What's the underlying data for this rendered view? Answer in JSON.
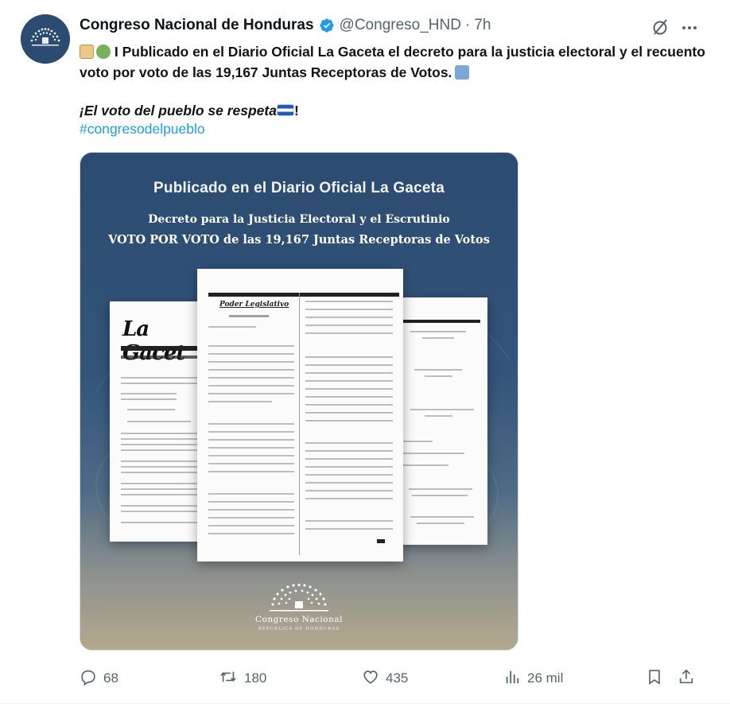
{
  "tweet": {
    "author_name": "Congreso Nacional de Honduras",
    "handle": "@Congreso_HND",
    "separator": "·",
    "time": "7h",
    "text_line1": " I Publicado en el Diario Oficial La Gaceta el decreto para la justicia electoral y el recuento voto por voto de las 19,167 Juntas Receptoras de Votos.",
    "text_line3": "¡El voto del pueblo se respeta",
    "text_line3_end": "!",
    "hashtag": "#congresodelpueblo"
  },
  "media": {
    "title": "Publicado en el Diario Oficial La Gaceta",
    "subtitle1": "Decreto para la Justicia Electoral y el Escrutinio",
    "subtitle2": "VOTO POR VOTO de las 19,167 Juntas Receptoras de Votos",
    "left_doc_logo": "La Gacet",
    "center_doc_heading": "Poder Legislativo",
    "congreso_name": "Congreso Nacional",
    "congreso_sub": "REPÚBLICA DE HONDURAS"
  },
  "actions": {
    "replies": "68",
    "reposts": "180",
    "likes": "435",
    "views": "26 mil"
  },
  "colors": {
    "link": "#1d9bf0",
    "muted": "#536471",
    "verified": "#1d9bf0",
    "media_bg": "#2b4b70"
  },
  "icons": [
    "verified-badge-icon",
    "grok-icon",
    "more-icon",
    "reply-icon",
    "retweet-icon",
    "like-icon",
    "views-icon",
    "bookmark-icon",
    "share-icon"
  ]
}
